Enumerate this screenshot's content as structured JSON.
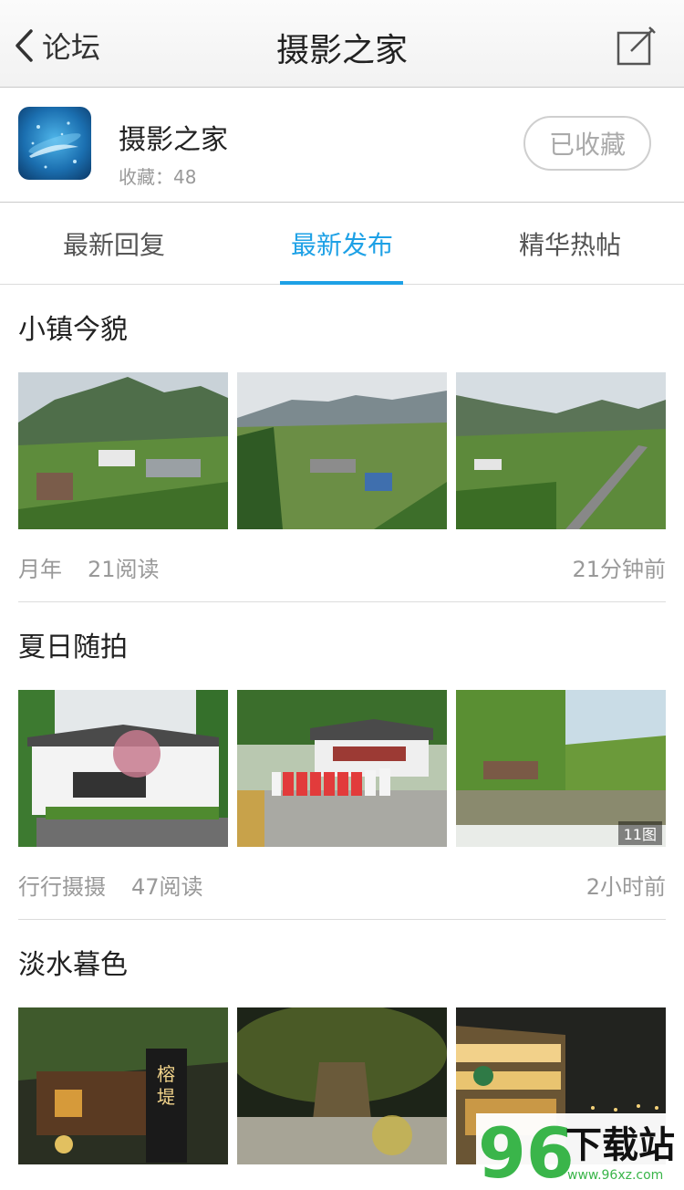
{
  "nav": {
    "back_label": "论坛",
    "title": "摄影之家"
  },
  "forum": {
    "name": "摄影之家",
    "favorites_label": "收藏：48",
    "favorited_label": "已收藏"
  },
  "tabs": [
    {
      "label": "最新回复",
      "active": false
    },
    {
      "label": "最新发布",
      "active": true
    },
    {
      "label": "精华热帖",
      "active": false
    }
  ],
  "posts": [
    {
      "title": "小镇今貌",
      "author": "月年",
      "reads": "21阅读",
      "time": "21分钟前",
      "image_count": ""
    },
    {
      "title": "夏日随拍",
      "author": "行行摄摄",
      "reads": "47阅读",
      "time": "2小时前",
      "image_count": "11图"
    },
    {
      "title": "淡水暮色",
      "author": "",
      "reads": "",
      "time": "",
      "image_count": ""
    }
  ],
  "watermark": {
    "number": "96",
    "text": "下载站",
    "url": "www.96xz.com"
  },
  "colors": {
    "accent": "#1ea1e6",
    "watermark_green": "#3ab54a"
  }
}
